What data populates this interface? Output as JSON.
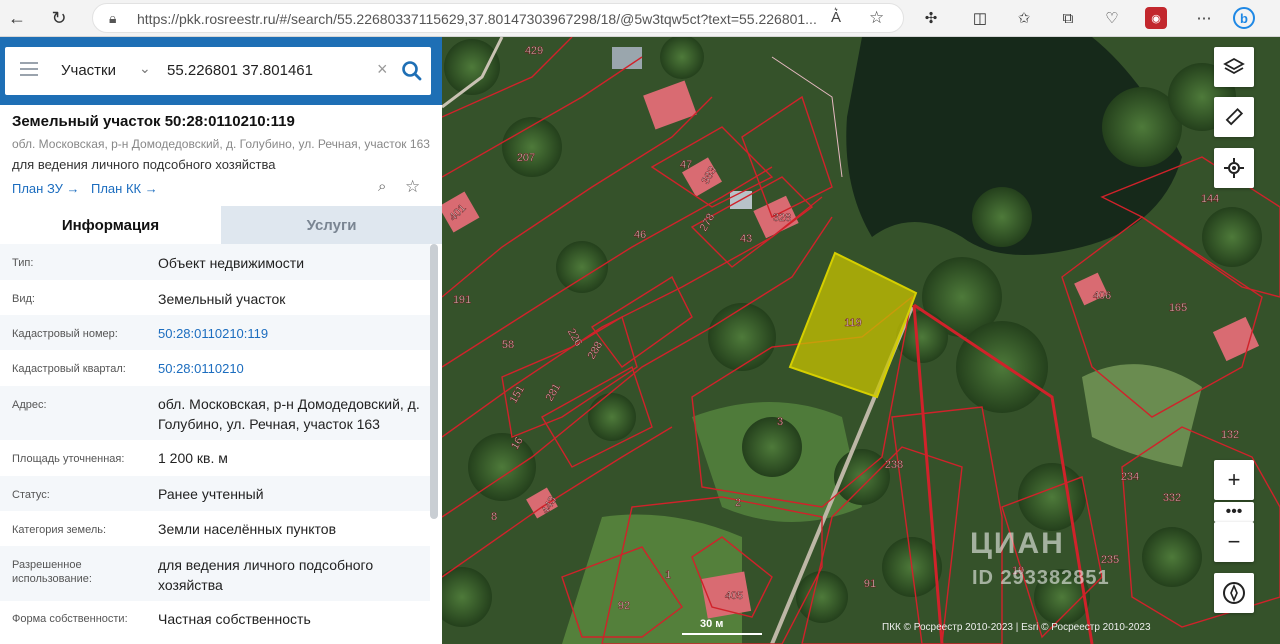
{
  "browser": {
    "url": "https://pkk.rosreestr.ru/#/search/55.22680337115629,37.80147303967298/18/@5w3tqw5ct?text=55.226801..."
  },
  "search": {
    "type_label": "Участки",
    "value": "55.226801 37.801461"
  },
  "parcel": {
    "title": "Земельный участок 50:28:0110210:119",
    "address": "обл. Московская, р-н Домодедовский, д. Голубино, ул. Речная, участок 163",
    "use": "для ведения личного подсобного хозяйства",
    "plan_zu": "План ЗУ →",
    "plan_kk": "План КК →"
  },
  "tabs": {
    "info": "Информация",
    "services": "Услуги"
  },
  "info_rows": [
    {
      "label": "Тип:",
      "value": "Объект недвижимости"
    },
    {
      "label": "Вид:",
      "value": "Земельный участок"
    },
    {
      "label": "Кадастровый номер:",
      "value": "50:28:0110210:119"
    },
    {
      "label": "Кадастровый квартал:",
      "value": "50:28:0110210"
    },
    {
      "label": "Адрес:",
      "value": "обл. Московская, р-н Домодедовский, д. Голубино, ул. Речная, участок 163"
    },
    {
      "label": "Площадь уточненная:",
      "value": "1 200 кв. м"
    },
    {
      "label": "Статус:",
      "value": "Ранее учтенный"
    },
    {
      "label": "Категория земель:",
      "value": "Земли населённых пунктов"
    },
    {
      "label": "Разрешенное",
      "label2": "использование:",
      "value": "для ведения личного подсобного хозяйства"
    },
    {
      "label": "Форма собственности:",
      "value": "Частная собственность"
    }
  ],
  "map": {
    "labels": [
      "429",
      "207",
      "401",
      "191",
      "58",
      "151",
      "16",
      "8",
      "443",
      "226",
      "288",
      "281",
      "47",
      "383",
      "46",
      "278",
      "43",
      "328",
      "119",
      "3",
      "2",
      "238",
      "1",
      "405",
      "92",
      "91",
      "19",
      "235",
      "234",
      "332",
      "132",
      "165",
      "406",
      "144"
    ],
    "scale": "30 м",
    "copyright": "ПКК © Росреестр 2010-2023 | Esri © Росреестр 2010-2023",
    "watermark": "ЦИАН",
    "watermark_id": "ID 293382851",
    "highlight_color": "#c8c300",
    "boundary_color": "#d0222a"
  }
}
